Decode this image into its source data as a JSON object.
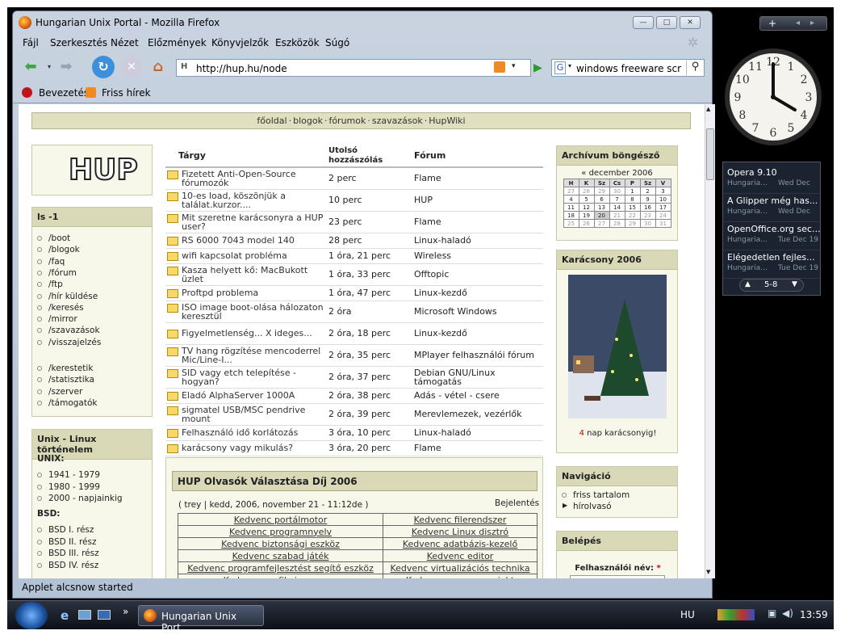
{
  "window": {
    "title": "Hungarian Unix Portal - Mozilla Firefox"
  },
  "menu": [
    "Fájl",
    "Szerkesztés",
    "Nézet",
    "Előzmények",
    "Könyvjelzők",
    "Eszközök",
    "Súgó"
  ],
  "nav": {
    "url": "http://hup.hu/node",
    "search_value": "windows freeware scree"
  },
  "bookmarks": [
    "Bevezetés",
    "Friss hírek"
  ],
  "topnav": [
    "főoldal",
    "blogok",
    "fórumok",
    "szavazások",
    "HupWiki"
  ],
  "ls_box": {
    "title": "ls -1",
    "items": [
      "/boot",
      "/blogok",
      "/faq",
      "/fórum",
      "/ftp",
      "/hír küldése",
      "/keresés",
      "/mirror",
      "/szavazások",
      "/visszajelzés"
    ],
    "items2": [
      "/kerestetik",
      "/statisztika",
      "/szerver",
      "/támogatók"
    ]
  },
  "history_box": {
    "title": "Unix - Linux történelem",
    "unix_label": "UNIX:",
    "unix": [
      "1941 - 1979",
      "1980 - 1999",
      "2000 - napjainkig"
    ],
    "bsd_label": "BSD:",
    "bsd": [
      "BSD I. rész",
      "BSD II. rész",
      "BSD III. rész",
      "BSD IV. rész"
    ]
  },
  "forum": {
    "headers": [
      "Tárgy",
      "Utolsó hozzászólás",
      "Fórum"
    ],
    "rows": [
      [
        "Fizetett Anti-Open-Source fórumozók",
        "2 perc",
        "Flame"
      ],
      [
        "10-es load, köszönjük a találat.kurzor....",
        "10 perc",
        "HUP"
      ],
      [
        "Mit szeretne karácsonyra a HUP user?",
        "23 perc",
        "Flame"
      ],
      [
        "RS 6000 7043 model 140",
        "28 perc",
        "Linux-haladó"
      ],
      [
        "wifi kapcsolat probléma",
        "1 óra, 21 perc",
        "Wireless"
      ],
      [
        "Kasza helyett kő: MacBukott üzlet",
        "1 óra, 33 perc",
        "Offtopic"
      ],
      [
        "Proftpd problema",
        "1 óra, 47 perc",
        "Linux-kezdő"
      ],
      [
        "ISO image boot-olása hálozaton keresztül",
        "2 óra",
        "Microsoft Windows"
      ],
      [
        "Figyelmetlenség... X ideges...",
        "2 óra, 18 perc",
        "Linux-kezdő"
      ],
      [
        "TV hang rögzítése mencoderrel Mic/Line-I...",
        "2 óra, 35 perc",
        "MPlayer felhasználói fórum"
      ],
      [
        "SID vagy etch telepítése - hogyan?",
        "2 óra, 37 perc",
        "Debian GNU/Linux támogatás"
      ],
      [
        "Eladó AlphaServer 1000A",
        "2 óra, 38 perc",
        "Adás - vétel - csere"
      ],
      [
        "sigmatel USB/MSC pendrive mount",
        "2 óra, 39 perc",
        "Merevlemezek, vezérlők"
      ],
      [
        "Felhasználó idő korlátozás",
        "3 óra, 10 perc",
        "Linux-haladó"
      ],
      [
        "karácsony vagy mikulás?",
        "3 óra, 20 perc",
        "Flame"
      ]
    ]
  },
  "poll": {
    "title": "HUP Olvasók Választása Díj 2006",
    "meta": "( trey | kedd, 2006, november 21 - 11:12de )",
    "login": "Bejelentés",
    "left": [
      "Kedvenc portálmotor",
      "Kedvenc programnyelv",
      "Kedvenc biztonsági eszköz",
      "Kedvenc szabad játék",
      "Kedvenc programfejlesztést segítő eszköz",
      "Kedvenc grafikai program"
    ],
    "right": [
      "Kedvenc filerendszer",
      "Kedvenc Linux disztró",
      "Kedvenc adatbázis-kezelő",
      "Kedvenc editor",
      "Kedvenc virtualizációs technika",
      "Kedvenc magyar projekt"
    ]
  },
  "archive": {
    "title": "Archívum böngésző",
    "month": "« december 2006",
    "days": [
      "H",
      "K",
      "Sz",
      "Cs",
      "P",
      "Sz",
      "V"
    ],
    "weeks": [
      [
        "27",
        "28",
        "29",
        "30",
        "1",
        "2",
        "3"
      ],
      [
        "4",
        "5",
        "6",
        "7",
        "8",
        "9",
        "10"
      ],
      [
        "11",
        "12",
        "13",
        "14",
        "15",
        "16",
        "17"
      ],
      [
        "18",
        "19",
        "20",
        "21",
        "22",
        "23",
        "24"
      ],
      [
        "25",
        "26",
        "27",
        "28",
        "29",
        "30",
        "31"
      ]
    ]
  },
  "xmas": {
    "title": "Karácsony 2006",
    "count": "4",
    "suffix": " nap karácsonyig!"
  },
  "navigation": {
    "title": "Navigáció",
    "items": [
      "friss tartalom",
      "hírolvasó"
    ]
  },
  "login": {
    "title": "Belépés",
    "user_label": "Felhasználói név:",
    "required": "*"
  },
  "status": "Applet alcsnow started",
  "taskbar": {
    "task": "Hungarian Unix Port...",
    "lang": "HU",
    "time": "13:59"
  },
  "feeds": {
    "items": [
      {
        "title": "Opera 9.10",
        "src": "Hungaria...",
        "date": "Wed Dec"
      },
      {
        "title": "A Glipper még has...",
        "src": "Hungaria...",
        "date": "Wed Dec"
      },
      {
        "title": "OpenOffice.org sec...",
        "src": "Hungaria...",
        "date": "Tue Dec 19"
      },
      {
        "title": "Elégedetlen fejles...",
        "src": "Hungaria...",
        "date": "Tue Dec 19"
      }
    ],
    "pager": "5-8"
  },
  "clock": {
    "numbers": [
      "12",
      "1",
      "2",
      "3",
      "4",
      "5",
      "6",
      "7",
      "8",
      "9",
      "10",
      "11"
    ],
    "time": "13:59"
  }
}
